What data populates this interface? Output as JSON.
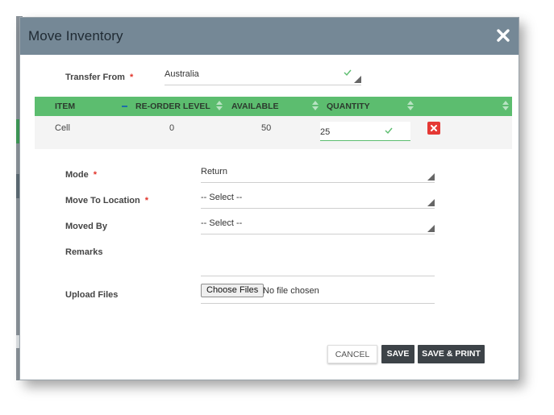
{
  "modal": {
    "title": "Move Inventory"
  },
  "transfer_from": {
    "label": "Transfer From",
    "required_mark": "*",
    "value": "Australia"
  },
  "grid": {
    "columns": [
      "ITEM",
      "RE-ORDER LEVEL",
      "AVAILABLE",
      "QUANTITY"
    ],
    "rows": [
      {
        "item": "Cell",
        "reorder_level": "0",
        "available": "50",
        "quantity": "25"
      }
    ]
  },
  "form": {
    "mode": {
      "label": "Mode",
      "required_mark": "*",
      "value": "Return"
    },
    "move_to_location": {
      "label": "Move To Location",
      "required_mark": "*",
      "value": "-- Select --"
    },
    "moved_by": {
      "label": "Moved By",
      "value": "-- Select --"
    },
    "remarks": {
      "label": "Remarks",
      "value": ""
    },
    "upload_files": {
      "label": "Upload Files",
      "button_label": "Choose Files",
      "status": "No file chosen"
    }
  },
  "actions": {
    "cancel_label": "CANCEL",
    "save_label": "SAVE",
    "save_print_label": "SAVE & PRINT"
  },
  "colors": {
    "header_bg": "#758896",
    "grid_header_bg": "#5cbd6f",
    "required": "#e2342a",
    "delete_btn": "#e53935",
    "primary_btn": "#3d4348"
  },
  "icons": {
    "close": "close-icon",
    "check": "check-icon",
    "sort": "sort-icon",
    "delete": "delete-icon",
    "dropdown": "dropdown-triangle-icon"
  }
}
